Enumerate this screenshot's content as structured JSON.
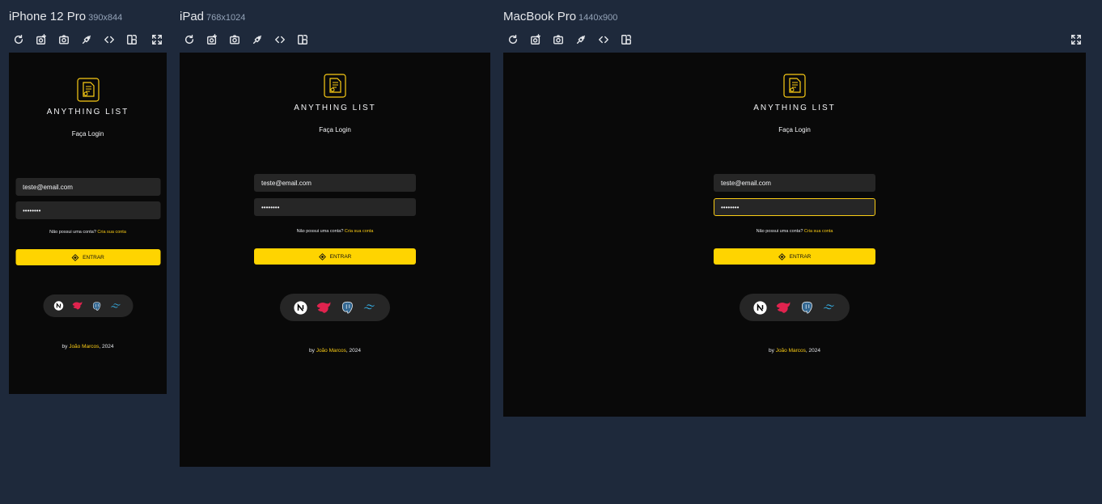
{
  "devices": {
    "iphone": {
      "name": "iPhone 12 Pro",
      "dims": "390x844"
    },
    "ipad": {
      "name": "iPad",
      "dims": "768x1024"
    },
    "macbook": {
      "name": "MacBook Pro",
      "dims": "1440x900"
    }
  },
  "toolbar": {
    "icons": [
      "refresh-icon",
      "screenshot-full-icon",
      "camera-icon",
      "plug-icon",
      "code-icon",
      "rotate-icon",
      "fullscreen-icon"
    ]
  },
  "app": {
    "brand": "ANYTHING LIST",
    "subtitle": "Faça Login",
    "email_value": "teste@email.com",
    "password_value": "••••••••",
    "signup_prompt": "Não possui uma conta?",
    "signup_link": "Cria sua conta",
    "login_button": "ENTRAR",
    "footer_prefix": "by ",
    "footer_author": "João Marcos",
    "footer_suffix": ", 2024",
    "tech_stack": [
      "nextjs-icon",
      "nestjs-icon",
      "postgresql-icon",
      "tailwind-icon"
    ]
  },
  "colors": {
    "page_bg": "#1e293b",
    "screen_bg": "#090909",
    "accent": "#facc15",
    "button": "#ffd400",
    "field_bg": "#262626"
  }
}
